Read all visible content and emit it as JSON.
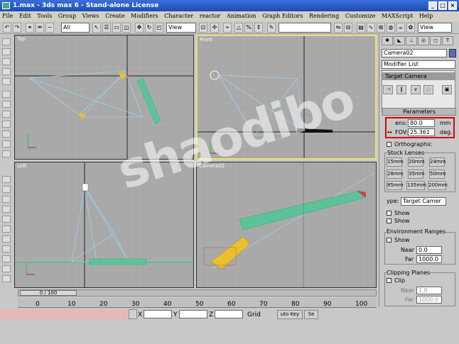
{
  "window": {
    "title": "1.max - 3ds max 6 - Stand-alone License"
  },
  "menu": [
    "File",
    "Edit",
    "Tools",
    "Group",
    "Views",
    "Create",
    "Modifiers",
    "Character",
    "reactor",
    "Animation",
    "Graph Editors",
    "Rendering",
    "Customize",
    "MAXScript",
    "Help"
  ],
  "toolbar": {
    "selection_filter": "All",
    "ref_coord": "View",
    "named_sel": "",
    "right_view": "View"
  },
  "viewports": {
    "top": "Top",
    "front": "Front",
    "left": "Left",
    "camera": "Camera02"
  },
  "watermark": "shaodibo",
  "command_panel": {
    "object_name": "Camera02",
    "modifier_list": "Modifier List",
    "stack_item": "Target Camera",
    "parameters_title": "Parameters",
    "lens_label": "ens:",
    "lens_value": "80.0",
    "lens_unit": "mm",
    "fov_label": "FOV:",
    "fov_value": "25.361",
    "fov_unit": "deg.",
    "orthographic": "Orthographic",
    "stock_lenses_title": "Stock Lenses",
    "stock_lenses": [
      "15mm",
      "20mm",
      "24mm",
      "28mm",
      "35mm",
      "50mm",
      "85mm",
      "135mm",
      "200mm"
    ],
    "type_label": "ype:",
    "type_value": "Target Camer",
    "show_cone": "Show",
    "show_horizon": "Show",
    "env_ranges_title": "Environment Ranges",
    "env_show": "Show",
    "near_label": "Near",
    "near_value": "0.0",
    "far_label": "Far",
    "far_value": "1000.0",
    "clip_title": "Clipping Planes",
    "clip_label": "Clip",
    "clip_near_label": "Near",
    "clip_near_value": "1.0",
    "clip_far_label": "Far",
    "clip_far_value": "1000.0"
  },
  "timeline": {
    "frame_display": "0 / 100",
    "ticks": [
      "0",
      "10",
      "20",
      "30",
      "40",
      "50",
      "60",
      "70",
      "80",
      "90",
      "100"
    ]
  },
  "status": {
    "x_label": "X",
    "y_label": "Y",
    "z_label": "Z",
    "grid_label": "Grid",
    "autokey": "uto Key",
    "setkey": "Se"
  },
  "colors": {
    "title_bar": "#1c4cb5",
    "highlight_red": "#e00000",
    "active_viewport": "#e8e070"
  }
}
